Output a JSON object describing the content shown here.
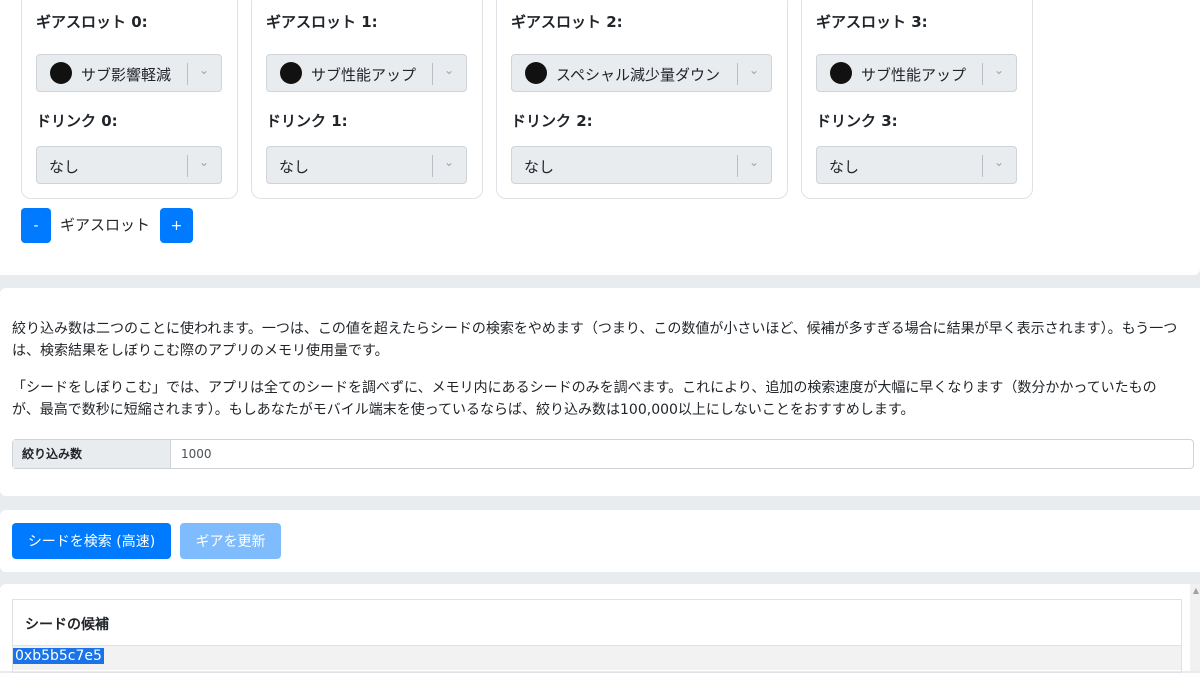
{
  "gear_slots": [
    {
      "slot_label": "ギアスロット 0:",
      "ability": "サブ影響軽減",
      "ability_icon": "sub-effect-reduction-icon",
      "drink_label": "ドリンク 0:",
      "drink_value": "なし"
    },
    {
      "slot_label": "ギアスロット 1:",
      "ability": "サブ性能アップ",
      "ability_icon": "sub-power-up-icon",
      "drink_label": "ドリンク 1:",
      "drink_value": "なし"
    },
    {
      "slot_label": "ギアスロット 2:",
      "ability": "スペシャル減少量ダウン",
      "ability_icon": "special-saver-icon",
      "drink_label": "ドリンク 2:",
      "drink_value": "なし"
    },
    {
      "slot_label": "ギアスロット 3:",
      "ability": "サブ性能アップ",
      "ability_icon": "sub-power-up-icon",
      "drink_label": "ドリンク 3:",
      "drink_value": "なし"
    }
  ],
  "slot_controls": {
    "minus": "-",
    "label": "ギアスロット",
    "plus": "+"
  },
  "narrow": {
    "para1": "絞り込み数は二つのことに使われます。一つは、この値を超えたらシードの検索をやめます（つまり、この数値が小さいほど、候補が多すぎる場合に結果が早く表示されます）。もう一つは、検索結果をしぼりこむ際のアプリのメモリ使用量です。",
    "para2": "「シードをしぼりこむ」では、アプリは全てのシードを調べずに、メモリ内にあるシードのみを調べます。これにより、追加の検索速度が大幅に早くなります（数分かかっていたものが、最高で数秒に短縮されます）。もしあなたがモバイル端末を使っているならば、絞り込み数は100,000以上にしないことをおすすめします。",
    "input_label": "絞り込み数",
    "input_value": "1000"
  },
  "actions": {
    "search": "シードを検索 (高速)",
    "update": "ギアを更新"
  },
  "results": {
    "header": "シードの候補",
    "rows": [
      "0xb5b5c7e5"
    ]
  },
  "colors": {
    "primary": "#007bff",
    "primary_disabled": "#7fbcfd",
    "page_bg": "#e9ecef",
    "selection": "#1a73e8"
  }
}
